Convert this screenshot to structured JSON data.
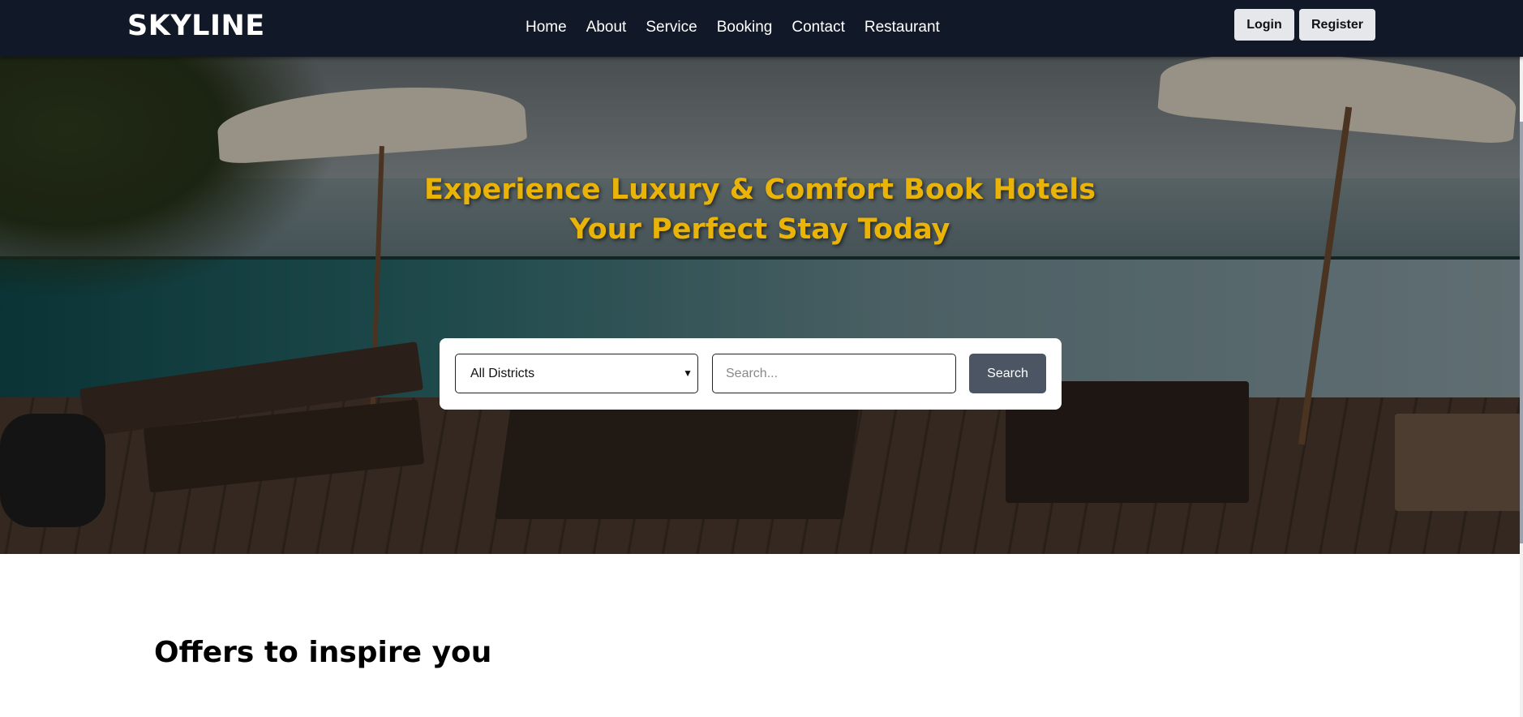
{
  "brand": "SKYLINE",
  "nav": {
    "links": [
      "Home",
      "About",
      "Service",
      "Booking",
      "Contact",
      "Restaurant"
    ],
    "login_label": "Login",
    "register_label": "Register"
  },
  "hero": {
    "title_line1": "Experience Luxury & Comfort Book Hotels",
    "title_line2": "Your Perfect Stay Today",
    "district_select_value": "All Districts",
    "search_placeholder": "Search...",
    "search_button_label": "Search"
  },
  "offers": {
    "title": "Offers to inspire you"
  },
  "colors": {
    "navbar": "#111827",
    "hero_title": "#eab308",
    "search_button": "#4b5563"
  }
}
